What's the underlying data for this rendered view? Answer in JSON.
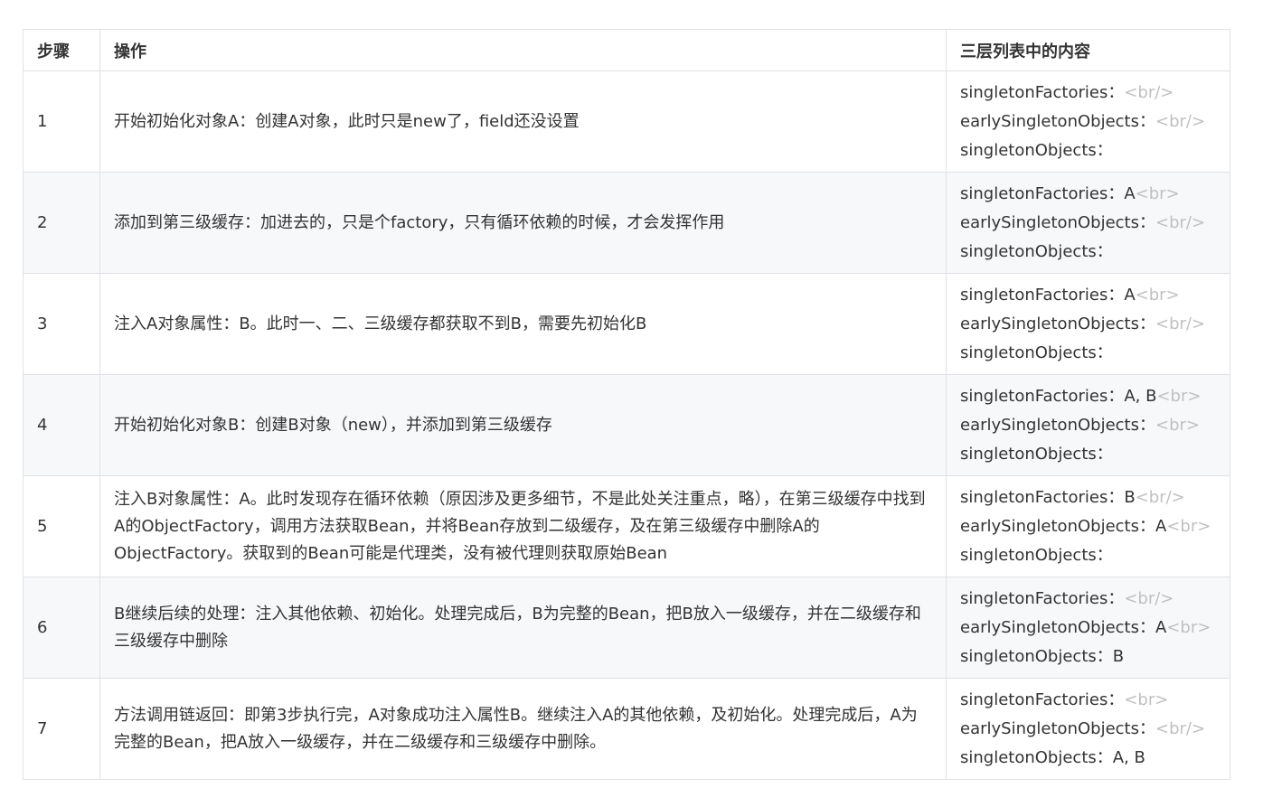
{
  "headers": [
    "步骤",
    "操作",
    "三层列表中的内容"
  ],
  "rows": [
    {
      "step": "1",
      "op": "开始初始化对象A：创建A对象，此时只是new了，field还没设置",
      "cache": [
        {
          "label": "singletonFactories：",
          "value": "",
          "tag": "<br/>"
        },
        {
          "label": "earlySingletonObjects：",
          "value": "",
          "tag": "<br/>"
        },
        {
          "label": "singletonObjects：",
          "value": "",
          "tag": ""
        }
      ]
    },
    {
      "step": "2",
      "op": "添加到第三级缓存：加进去的，只是个factory，只有循环依赖的时候，才会发挥作用",
      "cache": [
        {
          "label": "singletonFactories：",
          "value": "A",
          "tag": "<br>"
        },
        {
          "label": "earlySingletonObjects：",
          "value": "",
          "tag": "<br/>"
        },
        {
          "label": "singletonObjects：",
          "value": "",
          "tag": ""
        }
      ]
    },
    {
      "step": "3",
      "op": "注入A对象属性：B。此时一、二、三级缓存都获取不到B，需要先初始化B",
      "cache": [
        {
          "label": "singletonFactories：",
          "value": "A",
          "tag": "<br>"
        },
        {
          "label": "earlySingletonObjects：",
          "value": "",
          "tag": "<br/>"
        },
        {
          "label": "singletonObjects：",
          "value": "",
          "tag": ""
        }
      ]
    },
    {
      "step": "4",
      "op": "开始初始化对象B：创建B对象（new），并添加到第三级缓存",
      "cache": [
        {
          "label": "singletonFactories：",
          "value": "A, B",
          "tag": "<br>"
        },
        {
          "label": "earlySingletonObjects：",
          "value": "",
          "tag": "<br>"
        },
        {
          "label": "singletonObjects：",
          "value": "",
          "tag": ""
        }
      ]
    },
    {
      "step": "5",
      "op": "注入B对象属性：A。此时发现存在循环依赖（原因涉及更多细节，不是此处关注重点，略），在第三级缓存中找到A的ObjectFactory，调用方法获取Bean，并将Bean存放到二级缓存，及在第三级缓存中删除A的ObjectFactory。获取到的Bean可能是代理类，没有被代理则获取原始Bean",
      "cache": [
        {
          "label": "singletonFactories：",
          "value": "B",
          "tag": "<br/>"
        },
        {
          "label": "earlySingletonObjects：",
          "value": "A",
          "tag": "<br>"
        },
        {
          "label": "singletonObjects：",
          "value": "",
          "tag": ""
        }
      ]
    },
    {
      "step": "6",
      "op": "B继续后续的处理：注入其他依赖、初始化。处理完成后，B为完整的Bean，把B放入一级缓存，并在二级缓存和三级缓存中删除",
      "cache": [
        {
          "label": "singletonFactories：",
          "value": "",
          "tag": "<br/>"
        },
        {
          "label": "earlySingletonObjects：",
          "value": "A",
          "tag": "<br>"
        },
        {
          "label": "singletonObjects：",
          "value": "B",
          "tag": ""
        }
      ]
    },
    {
      "step": "7",
      "op": "方法调用链返回：即第3步执行完，A对象成功注入属性B。继续注入A的其他依赖，及初始化。处理完成后，A为完整的Bean，把A放入一级缓存，并在二级缓存和三级缓存中删除。",
      "cache": [
        {
          "label": "singletonFactories：",
          "value": "",
          "tag": "<br>"
        },
        {
          "label": "earlySingletonObjects：",
          "value": "",
          "tag": "<br/>"
        },
        {
          "label": "singletonObjects：",
          "value": "A, B",
          "tag": ""
        }
      ]
    }
  ]
}
